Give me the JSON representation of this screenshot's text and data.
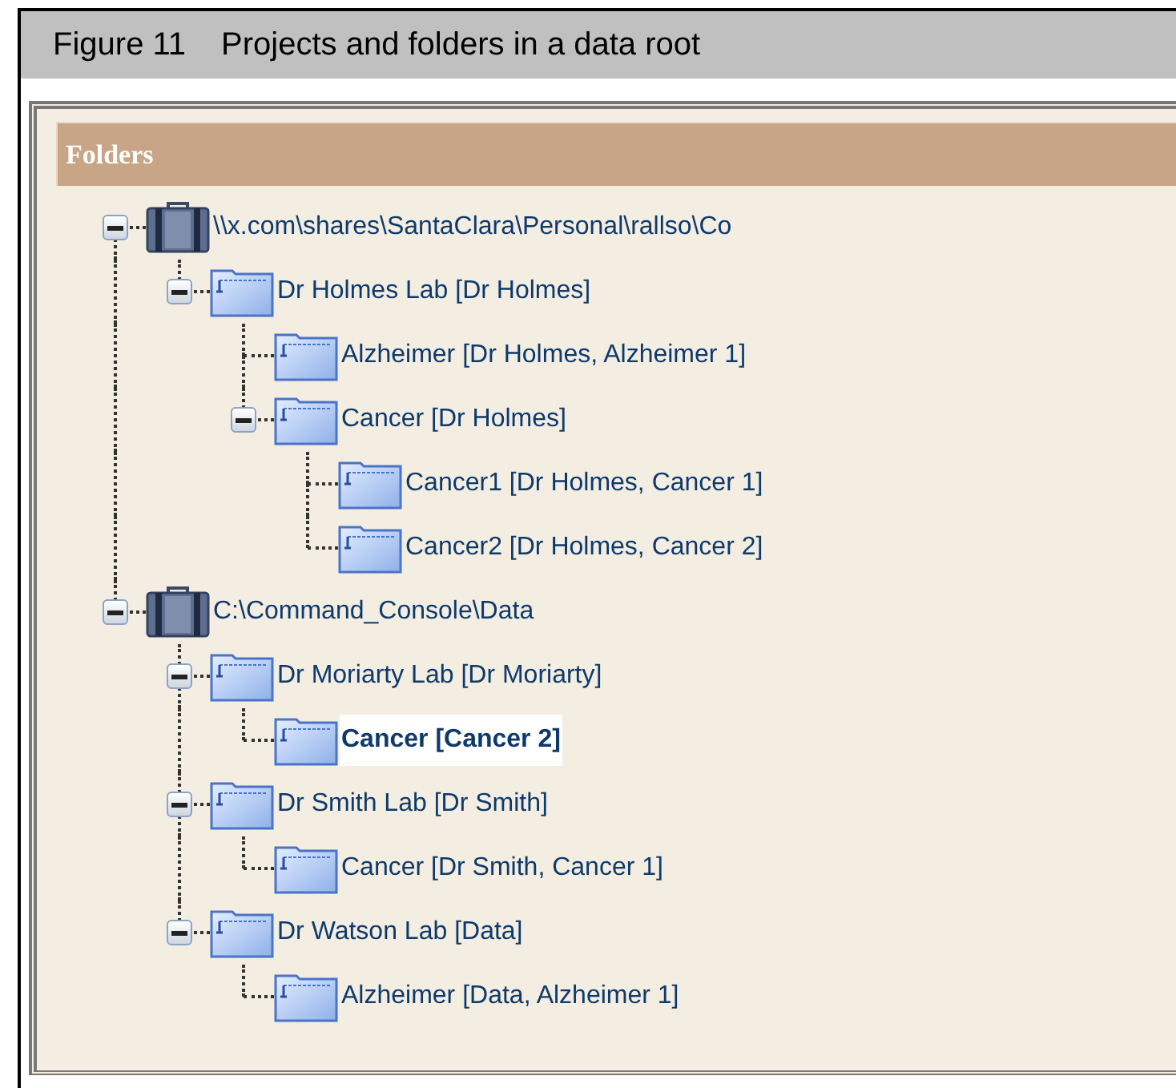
{
  "caption": {
    "label": "Figure 11",
    "title": "Projects and folders in a data root"
  },
  "panel": {
    "title": "Folders"
  },
  "tree": [
    {
      "kind": "drive",
      "label": "\\\\x.com\\shares\\SantaClara\\Personal\\rallso\\Co",
      "expanded": true,
      "selected": false,
      "children": [
        {
          "kind": "folder",
          "label": "Dr Holmes Lab [Dr Holmes]",
          "expanded": true,
          "selected": false,
          "children": [
            {
              "kind": "folder",
              "label": "Alzheimer [Dr Holmes, Alzheimer 1]",
              "selected": false
            },
            {
              "kind": "folder",
              "label": "Cancer [Dr Holmes]",
              "expanded": true,
              "selected": false,
              "children": [
                {
                  "kind": "folder",
                  "label": "Cancer1 [Dr Holmes, Cancer 1]",
                  "selected": false
                },
                {
                  "kind": "folder",
                  "label": "Cancer2 [Dr Holmes, Cancer 2]",
                  "selected": false
                }
              ]
            }
          ]
        }
      ]
    },
    {
      "kind": "drive",
      "label": "C:\\Command_Console\\Data",
      "expanded": true,
      "selected": false,
      "children": [
        {
          "kind": "folder",
          "label": "Dr Moriarty Lab [Dr Moriarty]",
          "expanded": true,
          "selected": false,
          "children": [
            {
              "kind": "folder",
              "label": "Cancer [Cancer 2]",
              "selected": true
            }
          ]
        },
        {
          "kind": "folder",
          "label": "Dr Smith Lab [Dr Smith]",
          "expanded": true,
          "selected": false,
          "children": [
            {
              "kind": "folder",
              "label": "Cancer [Dr Smith, Cancer 1]",
              "selected": false
            }
          ]
        },
        {
          "kind": "folder",
          "label": "Dr Watson Lab [Data]",
          "expanded": true,
          "selected": false,
          "children": [
            {
              "kind": "folder",
              "label": "Alzheimer [Data, Alzheimer 1]",
              "selected": false
            }
          ]
        }
      ]
    }
  ]
}
